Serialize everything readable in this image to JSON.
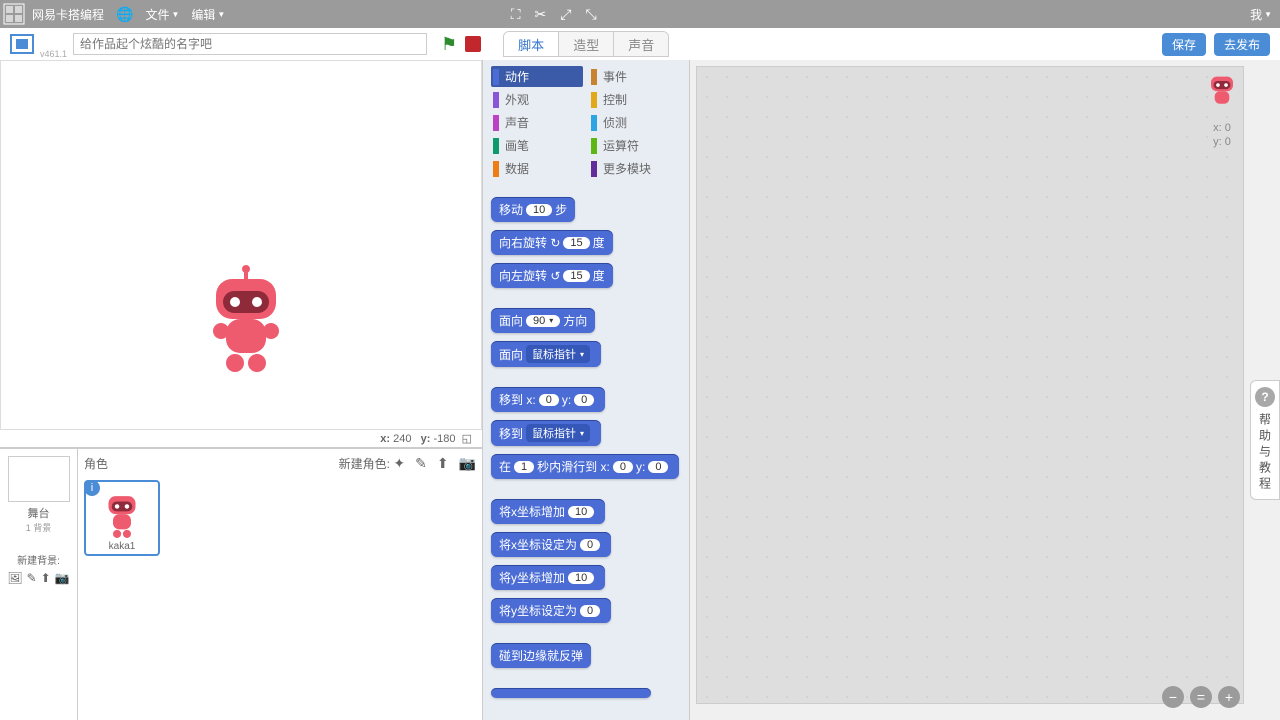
{
  "topbar": {
    "brand": "网易卡搭编程",
    "menu_file": "文件",
    "menu_edit": "编辑",
    "user": "我"
  },
  "header": {
    "version": "v461.1",
    "title_placeholder": "给作品起个炫酷的名字吧",
    "save": "保存",
    "publish": "去发布"
  },
  "tabs": {
    "script": "脚本",
    "costume": "造型",
    "sound": "声音"
  },
  "categories": [
    {
      "name": "动作",
      "color": "#4a6cd4",
      "active": true
    },
    {
      "name": "事件",
      "color": "#c88330"
    },
    {
      "name": "外观",
      "color": "#8a55d7"
    },
    {
      "name": "控制",
      "color": "#e1a91a"
    },
    {
      "name": "声音",
      "color": "#bb42c3"
    },
    {
      "name": "侦测",
      "color": "#2ca5e2"
    },
    {
      "name": "画笔",
      "color": "#0e9a6c"
    },
    {
      "name": "运算符",
      "color": "#5cb712"
    },
    {
      "name": "数据",
      "color": "#ee7d16"
    },
    {
      "name": "更多模块",
      "color": "#632d99"
    }
  ],
  "blocks": {
    "move": "移动",
    "steps_val": "10",
    "steps_suf": "步",
    "turn_r": "向右旋转 ↻",
    "turn_r_val": "15",
    "deg": "度",
    "turn_l": "向左旋转 ↺",
    "turn_l_val": "15",
    "point_dir": "面向",
    "point_dir_val": "90",
    "point_dir_suf": "方向",
    "point_to": "面向",
    "mouse": "鼠标指针",
    "goto_xy": "移到",
    "x": "x:",
    "y": "y:",
    "zero": "0",
    "goto": "移到",
    "glide_a": "在",
    "glide_secs": "1",
    "glide_b": "秒内滑行到",
    "chg_x": "将x坐标增加",
    "ten": "10",
    "set_x": "将x坐标设定为",
    "chg_y": "将y坐标增加",
    "set_y": "将y坐标设定为",
    "bounce": "碰到边缘就反弹"
  },
  "stage": {
    "coord_x_label": "x:",
    "coord_x": "240",
    "coord_y_label": "y:",
    "coord_y": "-180",
    "sprite_hdr": "角色",
    "new_sprite": "新建角色:",
    "stage_label": "舞台",
    "stage_sub": "1 背景",
    "new_bg": "新建背景:",
    "sprite_name": "kaka1"
  },
  "mini": {
    "x": "x: 0",
    "y": "y: 0"
  },
  "help": "帮助与教程"
}
